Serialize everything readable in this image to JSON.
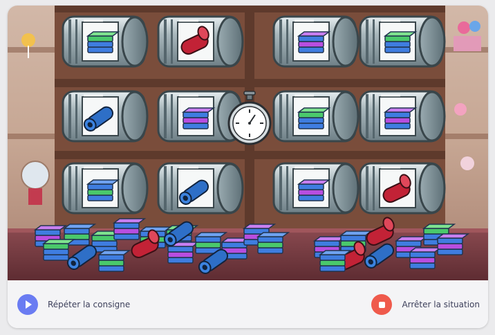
{
  "game": {
    "jars": [
      {
        "row": 1,
        "col": 1,
        "item": "candy-block-green-icon"
      },
      {
        "row": 1,
        "col": 2,
        "item": "licorice-red-icon"
      },
      {
        "row": 1,
        "col": 3,
        "item": "candy-block-purple-icon"
      },
      {
        "row": 1,
        "col": 4,
        "item": "candy-block-green-icon"
      },
      {
        "row": 2,
        "col": 1,
        "item": "licorice-blue-icon"
      },
      {
        "row": 2,
        "col": 2,
        "item": "candy-block-purple-icon"
      },
      {
        "row": 2,
        "col": 3,
        "item": "candy-block-green-icon"
      },
      {
        "row": 2,
        "col": 4,
        "item": "candy-block-purple-icon"
      },
      {
        "row": 3,
        "col": 1,
        "item": "candy-block-blue-icon"
      },
      {
        "row": 3,
        "col": 2,
        "item": "licorice-blue-icon"
      },
      {
        "row": 3,
        "col": 3,
        "item": "candy-block-purple-icon"
      },
      {
        "row": 3,
        "col": 4,
        "item": "licorice-red-icon"
      }
    ],
    "timer_icon": "stopwatch-icon"
  },
  "footer": {
    "repeat_label": "Répéter la consigne",
    "repeat_icon": "play-icon",
    "stop_label": "Arrêter la situation",
    "stop_icon": "stop-icon"
  },
  "colors": {
    "repeat_button": "#6a7cf2",
    "stop_button": "#ef5a4c"
  }
}
